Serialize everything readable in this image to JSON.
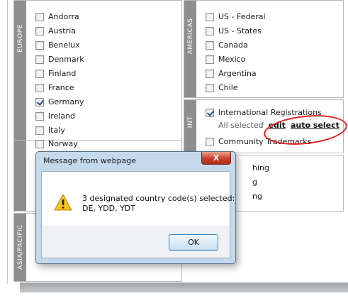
{
  "europe": {
    "tab_label": "EUROPE",
    "countries": [
      {
        "label": "Andorra",
        "checked": false
      },
      {
        "label": "Austria",
        "checked": false
      },
      {
        "label": "Benelux",
        "checked": false
      },
      {
        "label": "Denmark",
        "checked": false
      },
      {
        "label": "Finland",
        "checked": false
      },
      {
        "label": "France",
        "checked": false
      },
      {
        "label": "Germany",
        "checked": true
      },
      {
        "label": "Ireland",
        "checked": false
      },
      {
        "label": "Italy",
        "checked": false
      },
      {
        "label": "Norway",
        "checked": false
      }
    ]
  },
  "asia_pacific": {
    "tab_label": "ASIA/PACIFIC"
  },
  "americas": {
    "tab_label": "AMERICAS",
    "countries": [
      {
        "label": "US - Federal",
        "checked": false
      },
      {
        "label": "US - States",
        "checked": false
      },
      {
        "label": "Canada",
        "checked": false
      },
      {
        "label": "Mexico",
        "checked": false
      },
      {
        "label": "Argentina",
        "checked": false
      },
      {
        "label": "Chile",
        "checked": false
      }
    ]
  },
  "int": {
    "tab_label": "INT",
    "items": [
      {
        "label": "International Registrations",
        "checked": true
      },
      {
        "label": "Community Trademarks",
        "checked": false
      }
    ],
    "status_text": "All selected",
    "edit_link": "edit",
    "auto_select_link": "auto select"
  },
  "partial_rows": [
    "hing",
    "g",
    "ng"
  ],
  "dialog": {
    "title": "Message from webpage",
    "close_label": "X",
    "message_line1": "3 designated country code(s) selected:",
    "message_line2": "DE, YDD, YDT",
    "ok_label": "OK"
  },
  "colors": {
    "side_tab": "#8e8e8e",
    "annotation_red": "#e21d1d",
    "dialog_frame": "#c5d9ec"
  }
}
